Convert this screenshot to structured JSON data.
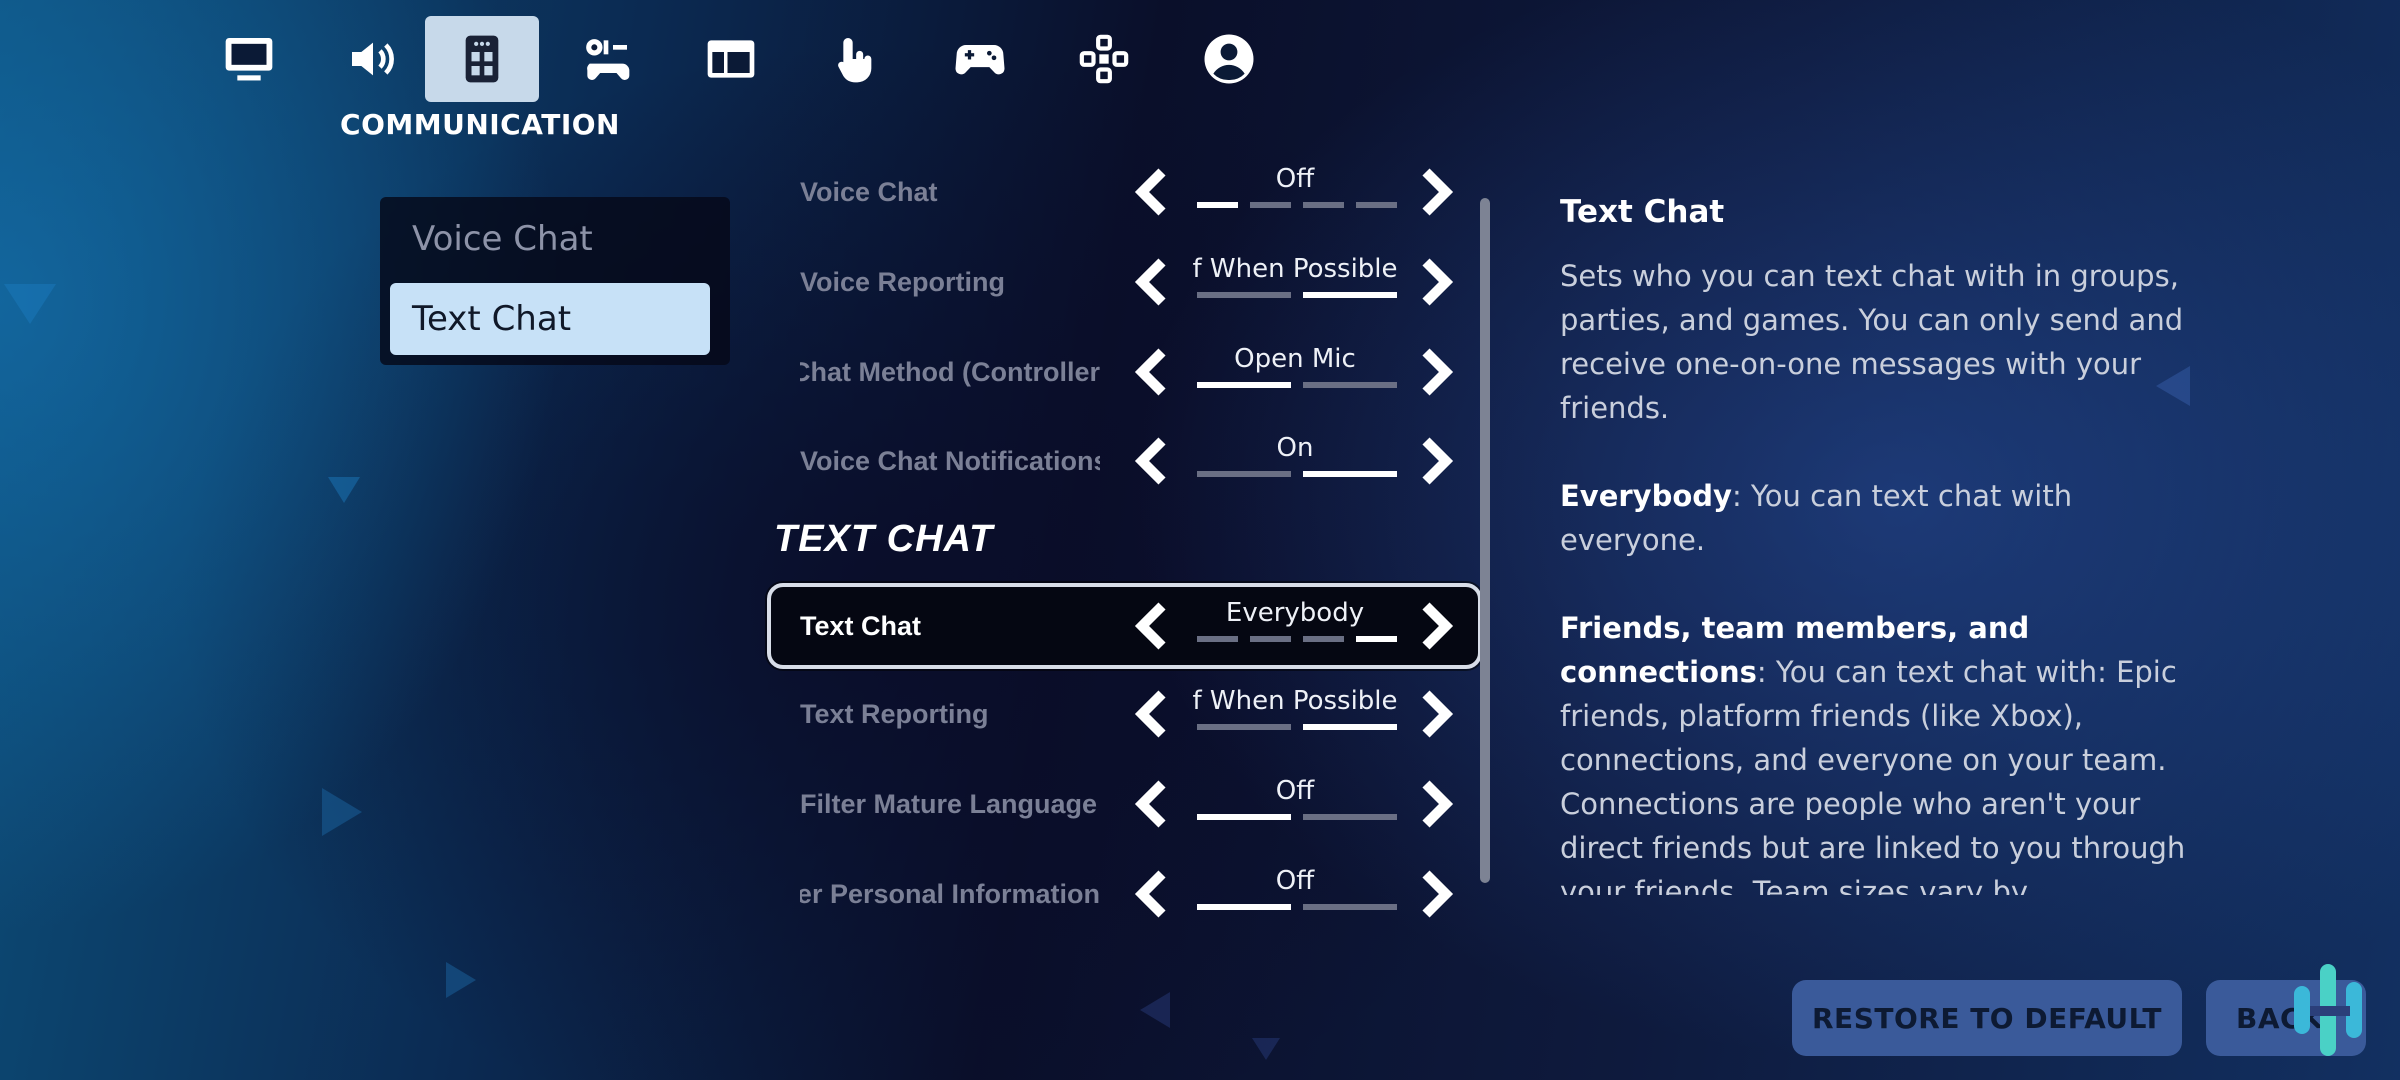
{
  "tabs": [
    {
      "icon": "monitor-icon",
      "active": false
    },
    {
      "icon": "speaker-icon",
      "active": false
    },
    {
      "icon": "communication-icon",
      "active": true
    },
    {
      "icon": "accessibility-icon",
      "active": false
    },
    {
      "icon": "layout-icon",
      "active": false
    },
    {
      "icon": "touch-icon",
      "active": false
    },
    {
      "icon": "controller-icon",
      "active": false
    },
    {
      "icon": "dpad-icon",
      "active": false
    },
    {
      "icon": "account-icon",
      "active": false
    }
  ],
  "active_tab_caption": "COMMUNICATION",
  "categories": [
    "Voice Chat",
    "Text Chat"
  ],
  "section_heading": "TEXT CHAT",
  "settings": [
    {
      "label": "Voice Chat",
      "value": "Off",
      "segments": 4,
      "active_segment": 1
    },
    {
      "label": "Voice Reporting",
      "value": "f When Possible",
      "segments": 2,
      "active_segment": 2
    },
    {
      "label": "Chat Method (Controller",
      "value": "Open Mic",
      "segments": 2,
      "active_segment": 1
    },
    {
      "label": "Voice Chat Notifications",
      "value": "On",
      "segments": 2,
      "active_segment": 2
    },
    {
      "label": "Text Chat",
      "value": "Everybody",
      "segments": 4,
      "active_segment": 4
    },
    {
      "label": "Text Reporting",
      "value": "f When Possible",
      "segments": 2,
      "active_segment": 2
    },
    {
      "label": "Filter Mature Language",
      "value": "Off",
      "segments": 2,
      "active_segment": 1
    },
    {
      "label": "ter Personal Information",
      "value": "Off",
      "segments": 2,
      "active_segment": 1
    }
  ],
  "description": {
    "title": "Text Chat",
    "intro": "Sets who you can text chat with in groups, parties, and games. You can only send and receive one-on-one messages with your friends.",
    "opt1_name": "Everybody",
    "opt1_text": ": You can text chat with everyone.",
    "opt2_name": "Friends, team members, and connections",
    "opt2_text": ": You can text chat with: Epic friends, platform friends (like Xbox), connections, and everyone on your team. Connections are people who aren't your direct friends but are linked to you through your friends. Team sizes vary by"
  },
  "buttons": {
    "restore": "RESTORE TO DEFAULT",
    "back": "BACK"
  },
  "colors": {
    "active_tab_bg": "#c7d9ea",
    "active_category_bg": "#c7e1f7",
    "button_bg": "#3a5a9a"
  }
}
